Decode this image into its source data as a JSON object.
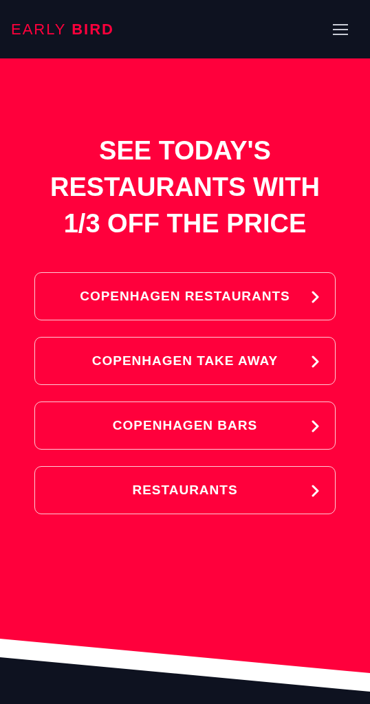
{
  "header": {
    "logo": "EARLY **BIRD**"
  },
  "hero": {
    "heading": "SEE TODAY'S RESTAURANTS WITH 1/3 OFF THE PRICE"
  },
  "links": [
    {
      "label": "COPENHAGEN RESTAURANTS"
    },
    {
      "label": "COPENHAGEN TAKE AWAY"
    },
    {
      "label": "COPENHAGEN BARS"
    },
    {
      "label": "RESTAURANTS"
    }
  ]
}
